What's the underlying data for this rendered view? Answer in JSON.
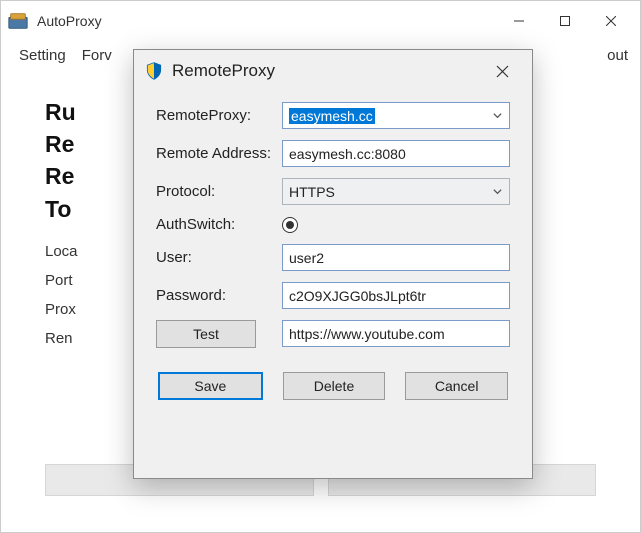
{
  "main": {
    "title": "AutoProxy",
    "menu": {
      "setting": "Setting",
      "forward": "Forv",
      "about_suffix": "out"
    },
    "heading_lines": [
      "Ru",
      "Re",
      "Re",
      "To"
    ],
    "rows": {
      "local": "Loca",
      "port": "Port",
      "proxy": "Prox",
      "remote": "Ren"
    }
  },
  "dialog": {
    "title": "RemoteProxy",
    "labels": {
      "remote_proxy": "RemoteProxy:",
      "remote_address": "Remote Address:",
      "protocol": "Protocol:",
      "auth_switch": "AuthSwitch:",
      "user": "User:",
      "password": "Password:"
    },
    "values": {
      "remote_proxy": "easymesh.cc",
      "remote_address": "easymesh.cc:8080",
      "protocol": "HTTPS",
      "auth_on": true,
      "user": "user2",
      "password": "c2O9XJGG0bsJLpt6tr",
      "test_url": "https://www.youtube.com"
    },
    "buttons": {
      "test": "Test",
      "save": "Save",
      "delete": "Delete",
      "cancel": "Cancel"
    }
  }
}
